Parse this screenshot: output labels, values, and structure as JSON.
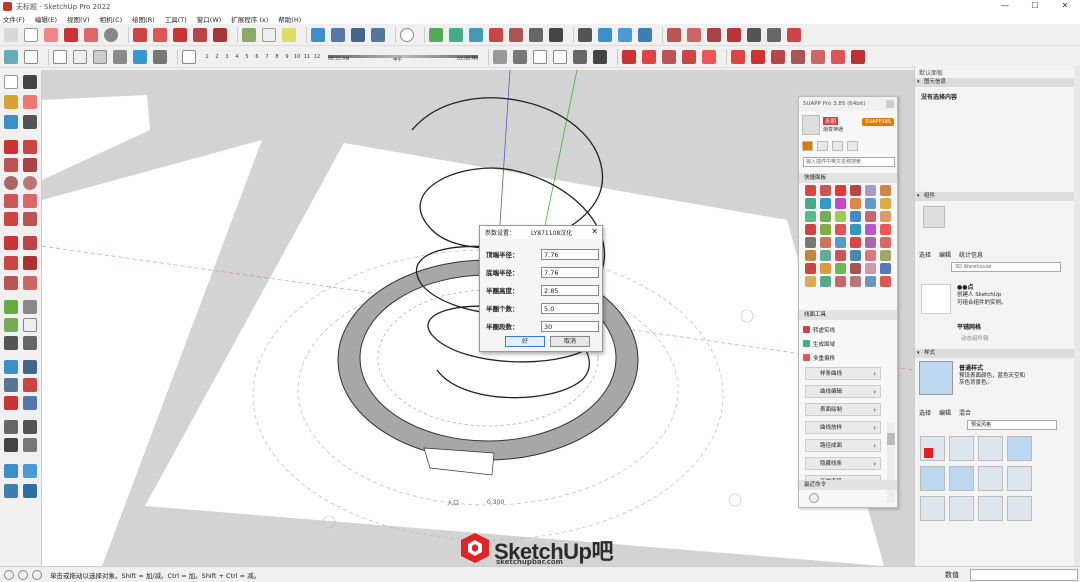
{
  "window": {
    "title": "无标题 - SketchUp Pro 2022",
    "minimize": "—",
    "maximize": "☐",
    "close": "✕"
  },
  "menu": [
    "文件(F)",
    "编辑(E)",
    "视图(V)",
    "相机(C)",
    "绘图(R)",
    "工具(T)",
    "窗口(W)",
    "扩展程序 (x)",
    "帮助(H)"
  ],
  "shadow": {
    "months": [
      "1",
      "2",
      "3",
      "4",
      "5",
      "6",
      "7",
      "8",
      "9",
      "10",
      "11",
      "12"
    ],
    "time_start": "06:55 AM",
    "time_mid": "中午",
    "time_end": "05:00 PM"
  },
  "dialog": {
    "title": "参数设置：",
    "subtitle": "LY871108汉化",
    "close": "✕",
    "fields": [
      {
        "label": "顶端半径：",
        "value": "7.76"
      },
      {
        "label": "底端半径：",
        "value": "7.76"
      },
      {
        "label": "半圈高度：",
        "value": "2.85"
      },
      {
        "label": "半圈个数：",
        "value": "5.0"
      },
      {
        "label": "半圈段数：",
        "value": "30"
      }
    ],
    "ok": "好",
    "cancel": "取消"
  },
  "suapp": {
    "title": "SUAPP Pro 3.85 (64bit)",
    "user_name": "永丽",
    "user_sub": "渐变神通",
    "badge": "SUAPP385",
    "search_placeholder": "输入插件中英文名称搜索",
    "quick_panel": "快捷面板",
    "line_tools": "线面工具",
    "tools": [
      "转虚实线",
      "生成面域",
      "多重偏移"
    ],
    "categories": [
      "样条曲线",
      "曲线编辑",
      "表面绘制",
      "曲线放样",
      "路径成面",
      "隐藏线条",
      "延伸连接"
    ],
    "recent": "最近命令"
  },
  "tray": {
    "title": "默认面板",
    "entity_info": "图元信息",
    "no_selection": "没有选择内容",
    "components": "组件",
    "comp_tabs": [
      "选择",
      "编辑",
      "统计信息"
    ],
    "warehouse": "3D Warehouse",
    "comp_name": "●●点",
    "comp_desc1": "创建人 SketchUp",
    "comp_desc2": "可组合组件的实例。",
    "grid_item": "平铺网格",
    "dynamic": "动态组件辑",
    "styles": "样式",
    "style_name": "普通样式",
    "style_desc": "预设表面颜色，蓝色天空和灰色背景色。",
    "style_tabs": [
      "选择",
      "编辑",
      "混合"
    ],
    "style_dropdown": "预设风格"
  },
  "scene": {
    "entrance": "入口",
    "dim": "0.300"
  },
  "status": {
    "text": "单击或拖动以选择对象。Shift = 加/减。Ctrl = 加。Shift + Ctrl = 减。",
    "vcb_label": "数值"
  },
  "watermark": {
    "brand": "SketchUp吧",
    "url": "sketchupbar.com"
  }
}
